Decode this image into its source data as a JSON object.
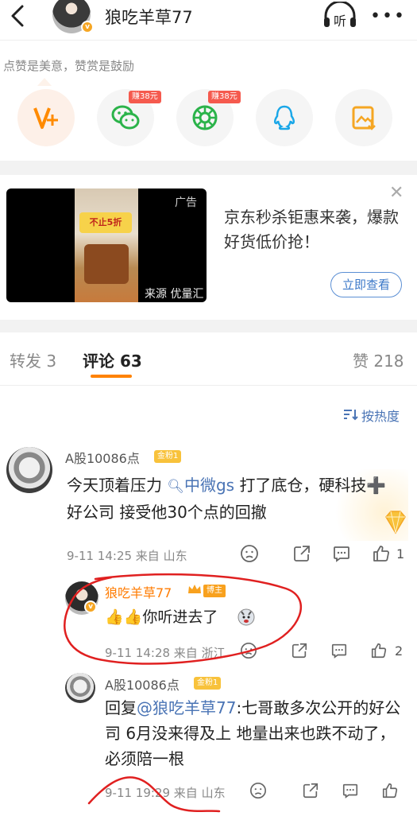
{
  "header": {
    "username": "狼吃羊草77",
    "listen_label": "听",
    "more_label": "•••"
  },
  "praise": {
    "tip": "点赞是美意，赞赏是鼓励"
  },
  "share": {
    "earn_badges": [
      "赚38元",
      "赚38元"
    ]
  },
  "ad": {
    "label": "广告",
    "source": "来源 优量汇",
    "text": "京东秒杀钜惠来袭，爆款好货低价抢！",
    "button": "立即查看",
    "close": "✕",
    "poster_text": "不止5折"
  },
  "tabs": {
    "repost": "转发 3",
    "comment": "评论 63",
    "like": "赞 218"
  },
  "sort_label": "按热度",
  "comments": [
    {
      "name": "A股10086点",
      "badge": "金粉1",
      "body_pre": "今天顶着压力",
      "topic": "中微gs",
      "body_post": "打了底仓，硬科技➕好公司  接受他30个点的回撤",
      "meta": "9-11 14:25  来自 山东",
      "likes": "1"
    },
    {
      "name": "狼吃羊草77",
      "badge": "博主",
      "body": "👍👍你听进去了",
      "meta": "9-11 14:28  来自 浙江",
      "likes": "2"
    },
    {
      "name": "A股10086点",
      "badge": "金粉1",
      "body_pre": "回复",
      "mention": "@狼吃羊草77",
      "body_post": ":七哥敢多次公开的好公司 6月没来得及上  地量出来也跌不动了，必须陪一根",
      "meta": "9-11 19:29  来自 山东"
    }
  ],
  "colors": {
    "accent": "#ff8200",
    "link": "#4a74b5",
    "annotation": "#e02020"
  }
}
